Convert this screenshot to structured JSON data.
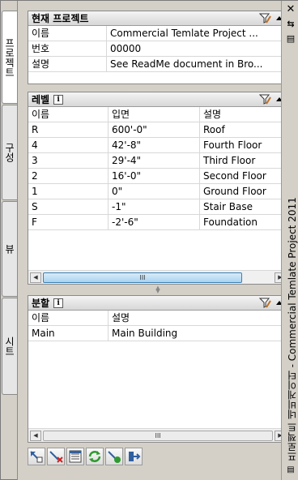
{
  "tabs": [
    {
      "label": "프로젝트",
      "active": true
    },
    {
      "label": "구성",
      "active": false
    },
    {
      "label": "뷰",
      "active": false
    },
    {
      "label": "시트",
      "active": false
    }
  ],
  "window": {
    "title": "프로젝트 네비게이터 - Commercial Temlate Project  2011",
    "close_glyph": "✕",
    "pin_glyph": "⇆",
    "props_glyph": "▤"
  },
  "current_project": {
    "title": "현재 프로젝트",
    "rows": [
      {
        "label": "이름",
        "value": "Commercial Temlate Project ..."
      },
      {
        "label": "번호",
        "value": "00000"
      },
      {
        "label": "설명",
        "value": "See ReadMe document in Bro..."
      }
    ]
  },
  "levels": {
    "title": "레벨",
    "info_glyph": "i",
    "columns": [
      "이름",
      "입면",
      "설명"
    ],
    "rows": [
      [
        "R",
        "600'-0\"",
        "Roof"
      ],
      [
        "4",
        "42'-8\"",
        "Fourth Floor"
      ],
      [
        "3",
        "29'-4\"",
        "Third Floor"
      ],
      [
        "2",
        "16'-0\"",
        "Second Floor"
      ],
      [
        "1",
        "0\"",
        "Ground Floor"
      ],
      [
        "S",
        "-1\"",
        "Stair Base"
      ],
      [
        "F",
        "-2'-6\"",
        "Foundation"
      ]
    ],
    "scroll_grip": "III"
  },
  "divisions": {
    "title": "분할",
    "info_glyph": "i",
    "columns": [
      "이름",
      "설명"
    ],
    "rows": [
      [
        "Main",
        "Main Building"
      ]
    ],
    "scroll_grip": "III"
  },
  "toolbar": {
    "buttons": [
      "add-icon",
      "delete-icon",
      "properties-icon",
      "refresh-icon",
      "repath-icon",
      "close-project-icon"
    ]
  },
  "colors": {
    "panel_bg": "#d4d0c8",
    "scroll_thumb": "#a9d3ef",
    "refresh_green": "#2e9a2e",
    "delete_red": "#cc2222"
  }
}
